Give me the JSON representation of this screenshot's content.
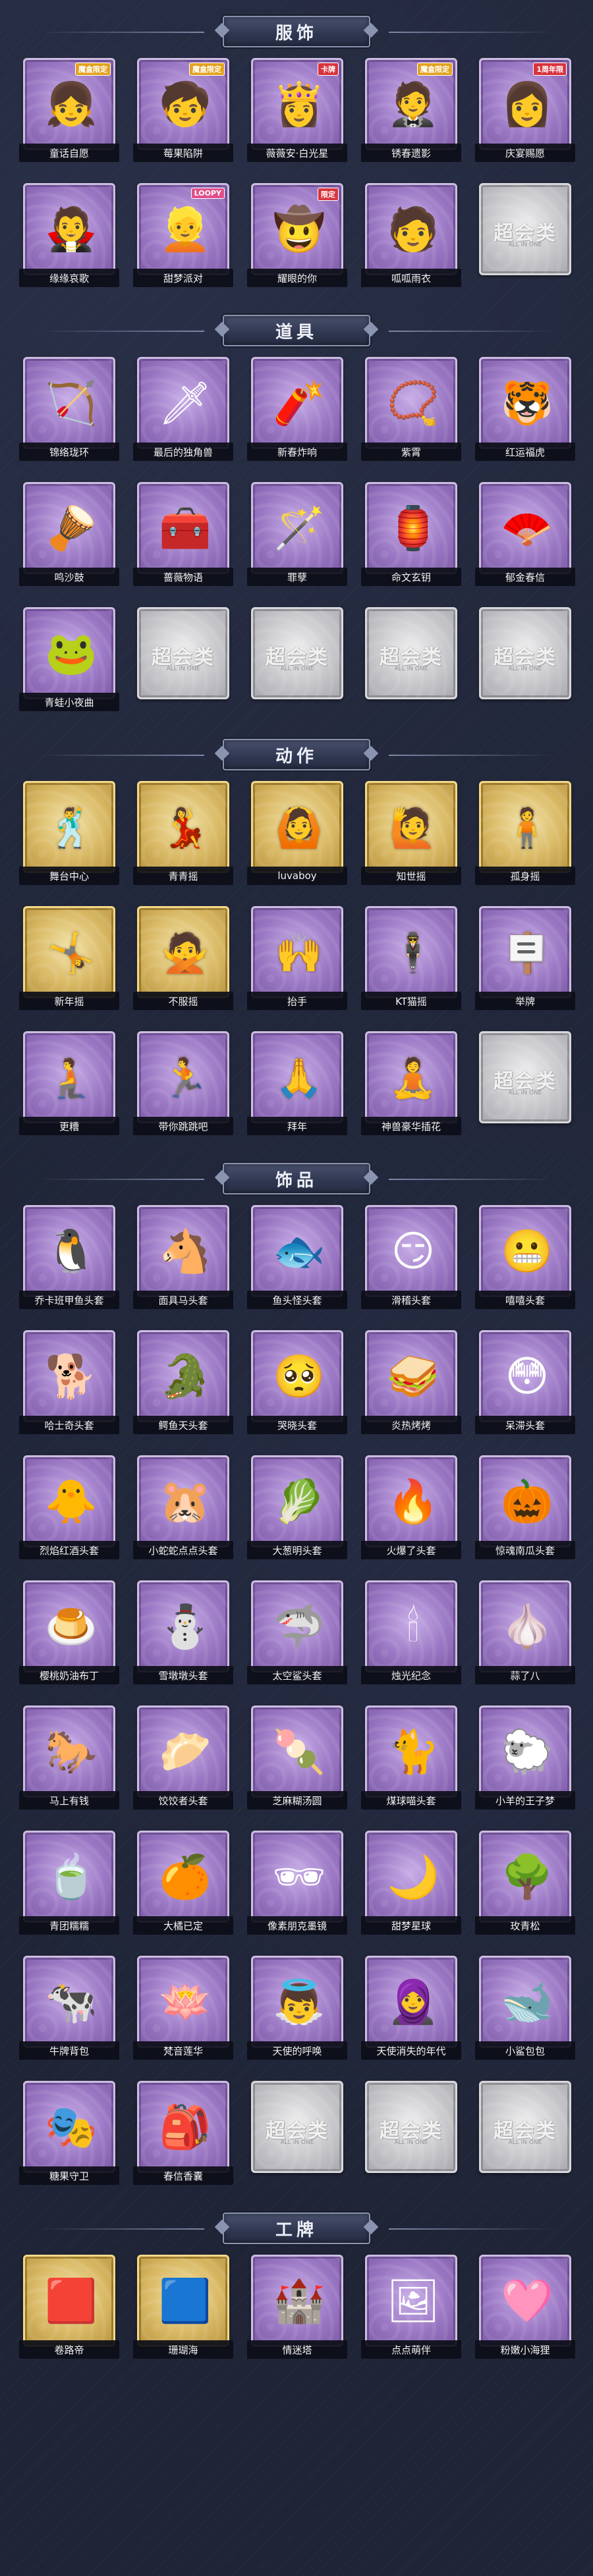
{
  "sections": [
    {
      "title": "服饰",
      "items": [
        {
          "label": "童话自愿",
          "icon": "👧",
          "badge": "魔盒限定",
          "badge_color": "gold",
          "tier": "purple"
        },
        {
          "label": "莓果陷阱",
          "icon": "🧒",
          "badge": "魔盒限定",
          "badge_color": "gold",
          "tier": "purple"
        },
        {
          "label": "薇薇安·白光星",
          "icon": "👸",
          "badge": "卡牌",
          "badge_color": "red",
          "tier": "purple"
        },
        {
          "label": "锈春遗影",
          "icon": "🤵",
          "badge": "魔盒限定",
          "badge_color": "gold",
          "tier": "purple"
        },
        {
          "label": "庆宴赐愿",
          "icon": "👩",
          "badge": "1周年限",
          "badge_color": "red",
          "tier": "purple"
        },
        {
          "label": "缘缘哀歌",
          "icon": "🧛",
          "badge": "",
          "badge_color": "",
          "tier": "purple"
        },
        {
          "label": "甜梦派对",
          "icon": "👱",
          "badge": "LOOPY",
          "badge_color": "pink",
          "tier": "purple"
        },
        {
          "label": "耀眼的你",
          "icon": "🤠",
          "badge": "限定",
          "badge_color": "red",
          "tier": "purple"
        },
        {
          "label": "呱呱雨衣",
          "icon": "🧑",
          "badge": "",
          "badge_color": "",
          "tier": "purple"
        },
        {
          "label": "",
          "icon": "",
          "badge": "",
          "badge_color": "",
          "tier": "silver"
        }
      ]
    },
    {
      "title": "道具",
      "items": [
        {
          "label": "锦络珑环",
          "icon": "🏹",
          "badge": "",
          "badge_color": "",
          "tier": "purple"
        },
        {
          "label": "最后的独角兽",
          "icon": "🗡",
          "badge": "",
          "badge_color": "",
          "tier": "purple"
        },
        {
          "label": "新春炸响",
          "icon": "🧨",
          "badge": "",
          "badge_color": "",
          "tier": "purple"
        },
        {
          "label": "紫霄",
          "icon": "📿",
          "badge": "",
          "badge_color": "",
          "tier": "purple"
        },
        {
          "label": "红运福虎",
          "icon": "🐯",
          "badge": "",
          "badge_color": "",
          "tier": "purple"
        },
        {
          "label": "鸣沙鼓",
          "icon": "🪘",
          "badge": "",
          "badge_color": "",
          "tier": "purple"
        },
        {
          "label": "蔷薇物语",
          "icon": "🧰",
          "badge": "",
          "badge_color": "",
          "tier": "purple"
        },
        {
          "label": "罪孽",
          "icon": "🪄",
          "badge": "",
          "badge_color": "",
          "tier": "purple"
        },
        {
          "label": "命文玄钥",
          "icon": "🏮",
          "badge": "",
          "badge_color": "",
          "tier": "purple"
        },
        {
          "label": "郁金春信",
          "icon": "🪭",
          "badge": "",
          "badge_color": "",
          "tier": "purple"
        },
        {
          "label": "青蛙小夜曲",
          "icon": "🐸",
          "badge": "",
          "badge_color": "",
          "tier": "purple"
        },
        {
          "label": "",
          "icon": "",
          "badge": "",
          "badge_color": "",
          "tier": "silver"
        },
        {
          "label": "",
          "icon": "",
          "badge": "",
          "badge_color": "",
          "tier": "silver"
        },
        {
          "label": "",
          "icon": "",
          "badge": "",
          "badge_color": "",
          "tier": "silver"
        },
        {
          "label": "",
          "icon": "",
          "badge": "",
          "badge_color": "",
          "tier": "silver"
        }
      ]
    },
    {
      "title": "动作",
      "items": [
        {
          "label": "舞台中心",
          "icon": "🕺",
          "badge": "",
          "badge_color": "",
          "tier": "gold"
        },
        {
          "label": "青青摇",
          "icon": "💃",
          "badge": "",
          "badge_color": "",
          "tier": "gold"
        },
        {
          "label": "luvaboy",
          "icon": "🙆",
          "badge": "",
          "badge_color": "",
          "tier": "gold"
        },
        {
          "label": "知世摇",
          "icon": "🙋",
          "badge": "",
          "badge_color": "",
          "tier": "gold"
        },
        {
          "label": "孤身摇",
          "icon": "🧍",
          "badge": "",
          "badge_color": "",
          "tier": "gold"
        },
        {
          "label": "新年摇",
          "icon": "🤸",
          "badge": "",
          "badge_color": "",
          "tier": "gold"
        },
        {
          "label": "不服摇",
          "icon": "🙅",
          "badge": "",
          "badge_color": "",
          "tier": "gold"
        },
        {
          "label": "抬手",
          "icon": "🙌",
          "badge": "",
          "badge_color": "",
          "tier": "purple"
        },
        {
          "label": "KT猫摇",
          "icon": "🕴",
          "badge": "",
          "badge_color": "",
          "tier": "purple"
        },
        {
          "label": "举牌",
          "icon": "🪧",
          "badge": "",
          "badge_color": "",
          "tier": "purple"
        },
        {
          "label": "更糟",
          "icon": "🧎",
          "badge": "",
          "badge_color": "",
          "tier": "purple"
        },
        {
          "label": "带你跳跳吧",
          "icon": "🏃",
          "badge": "",
          "badge_color": "",
          "tier": "purple"
        },
        {
          "label": "拜年",
          "icon": "🙏",
          "badge": "",
          "badge_color": "",
          "tier": "purple"
        },
        {
          "label": "神兽豪华插花",
          "icon": "🧘",
          "badge": "",
          "badge_color": "",
          "tier": "purple"
        },
        {
          "label": "",
          "icon": "",
          "badge": "",
          "badge_color": "",
          "tier": "silver"
        }
      ]
    },
    {
      "title": "饰品",
      "items": [
        {
          "label": "乔卡班甲鱼头套",
          "icon": "🐧",
          "badge": "",
          "badge_color": "",
          "tier": "purple"
        },
        {
          "label": "面具马头套",
          "icon": "🐴",
          "badge": "",
          "badge_color": "",
          "tier": "purple"
        },
        {
          "label": "鱼头怪头套",
          "icon": "🐟",
          "badge": "",
          "badge_color": "",
          "tier": "purple"
        },
        {
          "label": "滑稽头套",
          "icon": "😏",
          "badge": "",
          "badge_color": "",
          "tier": "purple"
        },
        {
          "label": "嘻嘻头套",
          "icon": "😬",
          "badge": "",
          "badge_color": "",
          "tier": "purple"
        },
        {
          "label": "哈士奇头套",
          "icon": "🐕",
          "badge": "",
          "badge_color": "",
          "tier": "purple"
        },
        {
          "label": "鳄鱼天头套",
          "icon": "🐊",
          "badge": "",
          "badge_color": "",
          "tier": "purple"
        },
        {
          "label": "哭晓头套",
          "icon": "🥺",
          "badge": "",
          "badge_color": "",
          "tier": "purple"
        },
        {
          "label": "炎热烤烤",
          "icon": "🥪",
          "badge": "",
          "badge_color": "",
          "tier": "purple"
        },
        {
          "label": "呆滞头套",
          "icon": "😳",
          "badge": "",
          "badge_color": "",
          "tier": "purple"
        },
        {
          "label": "烈焰红酒头套",
          "icon": "🐥",
          "badge": "",
          "badge_color": "",
          "tier": "purple"
        },
        {
          "label": "小蛇蛇点点头套",
          "icon": "🐹",
          "badge": "",
          "badge_color": "",
          "tier": "purple"
        },
        {
          "label": "大葱明头套",
          "icon": "🥬",
          "badge": "",
          "badge_color": "",
          "tier": "purple"
        },
        {
          "label": "火爆了头套",
          "icon": "🔥",
          "badge": "",
          "badge_color": "",
          "tier": "purple"
        },
        {
          "label": "惊魂南瓜头套",
          "icon": "🎃",
          "badge": "",
          "badge_color": "",
          "tier": "purple"
        },
        {
          "label": "樱桃奶油布丁",
          "icon": "🍮",
          "badge": "",
          "badge_color": "",
          "tier": "purple"
        },
        {
          "label": "雪墩墩头套",
          "icon": "⛄",
          "badge": "",
          "badge_color": "",
          "tier": "purple"
        },
        {
          "label": "太空鲨头套",
          "icon": "🦈",
          "badge": "",
          "badge_color": "",
          "tier": "purple"
        },
        {
          "label": "烛光纪念",
          "icon": "🕯",
          "badge": "",
          "badge_color": "",
          "tier": "purple"
        },
        {
          "label": "蒜了八",
          "icon": "🧄",
          "badge": "",
          "badge_color": "",
          "tier": "purple"
        },
        {
          "label": "马上有钱",
          "icon": "🐎",
          "badge": "",
          "badge_color": "",
          "tier": "purple"
        },
        {
          "label": "饺饺者头套",
          "icon": "🥟",
          "badge": "",
          "badge_color": "",
          "tier": "purple"
        },
        {
          "label": "芝麻糊汤圆",
          "icon": "🍡",
          "badge": "",
          "badge_color": "",
          "tier": "purple"
        },
        {
          "label": "煤球喵头套",
          "icon": "🐈",
          "badge": "",
          "badge_color": "",
          "tier": "purple"
        },
        {
          "label": "小羊的王子梦",
          "icon": "🐑",
          "badge": "",
          "badge_color": "",
          "tier": "purple"
        },
        {
          "label": "青团糯糯",
          "icon": "🍵",
          "badge": "",
          "badge_color": "",
          "tier": "purple"
        },
        {
          "label": "大橘已定",
          "icon": "🍊",
          "badge": "",
          "badge_color": "",
          "tier": "purple"
        },
        {
          "label": "像素朋克墨镜",
          "icon": "🕶",
          "badge": "",
          "badge_color": "",
          "tier": "purple"
        },
        {
          "label": "甜梦星球",
          "icon": "🌙",
          "badge": "",
          "badge_color": "",
          "tier": "purple"
        },
        {
          "label": "玫青松",
          "icon": "🌳",
          "badge": "",
          "badge_color": "",
          "tier": "purple"
        },
        {
          "label": "牛牌背包",
          "icon": "🐄",
          "badge": "",
          "badge_color": "",
          "tier": "purple"
        },
        {
          "label": "梵音莲华",
          "icon": "🪷",
          "badge": "",
          "badge_color": "",
          "tier": "purple"
        },
        {
          "label": "天使的呼唤",
          "icon": "👼",
          "badge": "",
          "badge_color": "",
          "tier": "purple"
        },
        {
          "label": "天使消失的年代",
          "icon": "🧕",
          "badge": "",
          "badge_color": "",
          "tier": "purple"
        },
        {
          "label": "小鲨包包",
          "icon": "🐋",
          "badge": "",
          "badge_color": "",
          "tier": "purple"
        },
        {
          "label": "糖果守卫",
          "icon": "🎭",
          "badge": "",
          "badge_color": "",
          "tier": "purple"
        },
        {
          "label": "春信香囊",
          "icon": "🎒",
          "badge": "",
          "badge_color": "",
          "tier": "purple"
        },
        {
          "label": "",
          "icon": "",
          "badge": "",
          "badge_color": "",
          "tier": "silver"
        },
        {
          "label": "",
          "icon": "",
          "badge": "",
          "badge_color": "",
          "tier": "silver"
        },
        {
          "label": "",
          "icon": "",
          "badge": "",
          "badge_color": "",
          "tier": "silver"
        }
      ]
    },
    {
      "title": "工牌",
      "items": [
        {
          "label": "卷路帝",
          "icon": "🟥",
          "badge": "",
          "badge_color": "",
          "tier": "gold"
        },
        {
          "label": "珊瑚海",
          "icon": "🟦",
          "badge": "",
          "badge_color": "",
          "tier": "gold"
        },
        {
          "label": "情迷塔",
          "icon": "🏰",
          "badge": "",
          "badge_color": "",
          "tier": "purple"
        },
        {
          "label": "点点萌伴",
          "icon": "🖼",
          "badge": "",
          "badge_color": "",
          "tier": "purple"
        },
        {
          "label": "粉嫩小海狸",
          "icon": "🩷",
          "badge": "",
          "badge_color": "",
          "tier": "purple"
        }
      ]
    }
  ],
  "placeholder": {
    "watermark": "超会类",
    "sub": "ALL IN ONE"
  },
  "colors": {
    "background": "#1f2436",
    "purple_frame": "#9b78c4",
    "gold_frame": "#d9b965",
    "silver_frame": "#c4c4c8",
    "label_bg": "#0c0e18"
  }
}
